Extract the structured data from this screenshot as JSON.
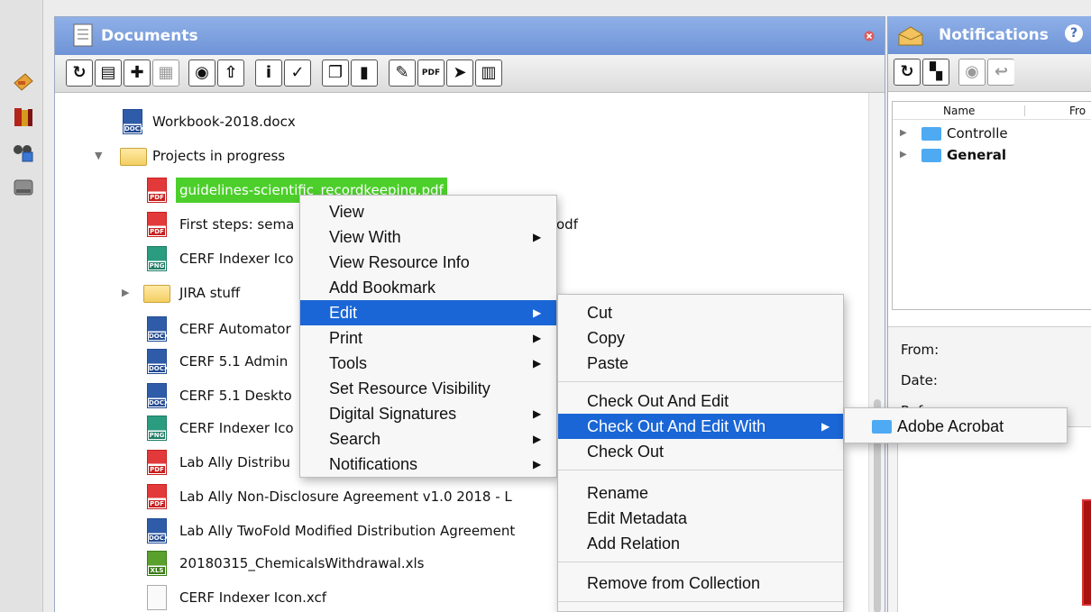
{
  "left_rail": {
    "icons": [
      "bookshelf-icon",
      "books-icon",
      "binoculars-save-icon",
      "drive-icon"
    ]
  },
  "documents_panel": {
    "title": "Documents",
    "toolbar_icons": [
      "refresh-icon",
      "new-document-icon",
      "add-icon",
      "properties-icon",
      "view-icon",
      "upload-icon",
      "info-icon",
      "metadata-icon",
      "copy-icon",
      "clipboard-icon",
      "sign-icon",
      "pdf-icon",
      "send-icon",
      "book-icon"
    ],
    "tree": [
      {
        "label": "Workbook-2018.docx",
        "type": "docx"
      },
      {
        "label": "Projects in progress",
        "type": "folder",
        "expanded": true
      },
      {
        "label": "guidelines-scientific_recordkeeping.pdf",
        "type": "pdf",
        "selected": true
      },
      {
        "label": "First steps: sema",
        "label_tail": "odf",
        "type": "pdf"
      },
      {
        "label": "CERF Indexer Ico",
        "type": "png"
      },
      {
        "label": "JIRA stuff",
        "type": "folder",
        "expanded": false
      },
      {
        "label": "CERF Automator",
        "type": "docx"
      },
      {
        "label": "CERF 5.1 Admin",
        "type": "docx"
      },
      {
        "label": "CERF 5.1 Deskto",
        "type": "docx"
      },
      {
        "label": "CERF Indexer Ico",
        "type": "png"
      },
      {
        "label": "Lab Ally Distribu",
        "type": "pdf"
      },
      {
        "label": "Lab Ally Non-Disclosure Agreement v1.0 2018 - L",
        "type": "pdf"
      },
      {
        "label": "Lab Ally TwoFold Modified Distribution Agreement",
        "type": "docx"
      },
      {
        "label": "20180315_ChemicalsWithdrawal.xls",
        "type": "xls"
      },
      {
        "label": "CERF Indexer Icon.xcf",
        "type": "xcf"
      }
    ]
  },
  "context_menu": {
    "items": [
      {
        "label": "View",
        "submenu": false
      },
      {
        "label": "View With",
        "submenu": true
      },
      {
        "label": "View Resource Info",
        "submenu": false
      },
      {
        "label": "Add Bookmark",
        "submenu": false
      },
      {
        "label": "Edit",
        "submenu": true,
        "selected": true
      },
      {
        "label": "Print",
        "submenu": true
      },
      {
        "label": "Tools",
        "submenu": true
      },
      {
        "label": "Set Resource Visibility",
        "submenu": false
      },
      {
        "label": "Digital Signatures",
        "submenu": true
      },
      {
        "label": "Search",
        "submenu": true
      },
      {
        "label": "Notifications",
        "submenu": true
      }
    ]
  },
  "edit_submenu": {
    "items": [
      "Cut",
      "Copy",
      "Paste",
      "Check Out And Edit",
      "Check Out And Edit With",
      "Check Out",
      "Rename",
      "Edit Metadata",
      "Add Relation",
      "Remove from Collection"
    ],
    "selected": "Check Out And Edit With"
  },
  "edit_with_submenu": {
    "items": [
      "Adobe Acrobat"
    ]
  },
  "notifications_panel": {
    "title": "Notifications",
    "help_icon": "?",
    "table_headers": [
      "Name",
      "Fro"
    ],
    "rows": [
      {
        "label": "Controlle",
        "bold": false
      },
      {
        "label": "General",
        "bold": true
      }
    ],
    "detail_labels": [
      "From:",
      "Date:",
      "Reference:"
    ]
  },
  "colors": {
    "header_blue": "#7197db",
    "selection_blue": "#1a66d6",
    "tree_selection_green": "#4ccf2b"
  }
}
